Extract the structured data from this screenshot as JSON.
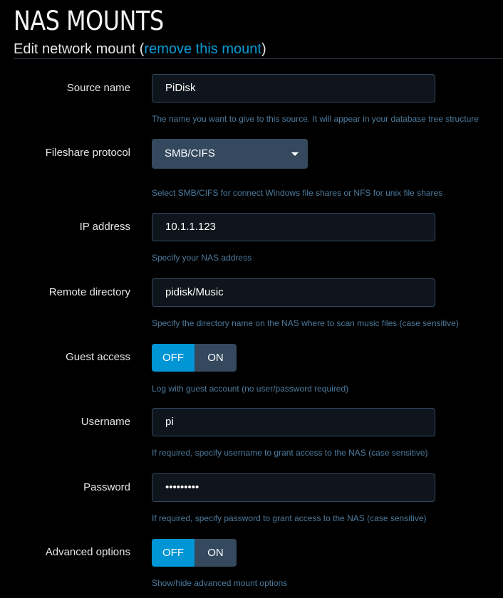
{
  "page": {
    "title": "NAS MOUNTS",
    "subtitle_prefix": "Edit network mount (",
    "remove_link": "remove this mount",
    "subtitle_suffix": ")"
  },
  "colors": {
    "accent": "#0095d5",
    "help_text": "#4d7a9c",
    "control_bg": "#34495e",
    "input_bg": "#0f151c"
  },
  "fields": {
    "source_name": {
      "label": "Source name",
      "value": "PiDisk",
      "help": "The name you want to give to this source. It will appear in your database tree structure"
    },
    "protocol": {
      "label": "Fileshare protocol",
      "value": "SMB/CIFS",
      "help": "Select SMB/CIFS for connect Windows file shares or NFS for unix file shares"
    },
    "ip": {
      "label": "IP address",
      "value": "10.1.1.123",
      "help": "Specify your NAS address"
    },
    "remote_dir": {
      "label": "Remote directory",
      "value": "pidisk/Music",
      "help": "Specify the directory name on the NAS where to scan music files (case sensitive)"
    },
    "guest": {
      "label": "Guest access",
      "off": "OFF",
      "on": "ON",
      "state": "off",
      "help": "Log with guest account (no user/password required)"
    },
    "username": {
      "label": "Username",
      "value": "pi",
      "help": "If required, specify username to grant access to the NAS (case sensitive)"
    },
    "password": {
      "label": "Password",
      "value": "•••••••••",
      "help": "If required, specify password to grant access to the NAS (case sensitive)"
    },
    "advanced": {
      "label": "Advanced options",
      "off": "OFF",
      "on": "ON",
      "state": "off",
      "help": "Show/hide advanced mount options"
    }
  }
}
